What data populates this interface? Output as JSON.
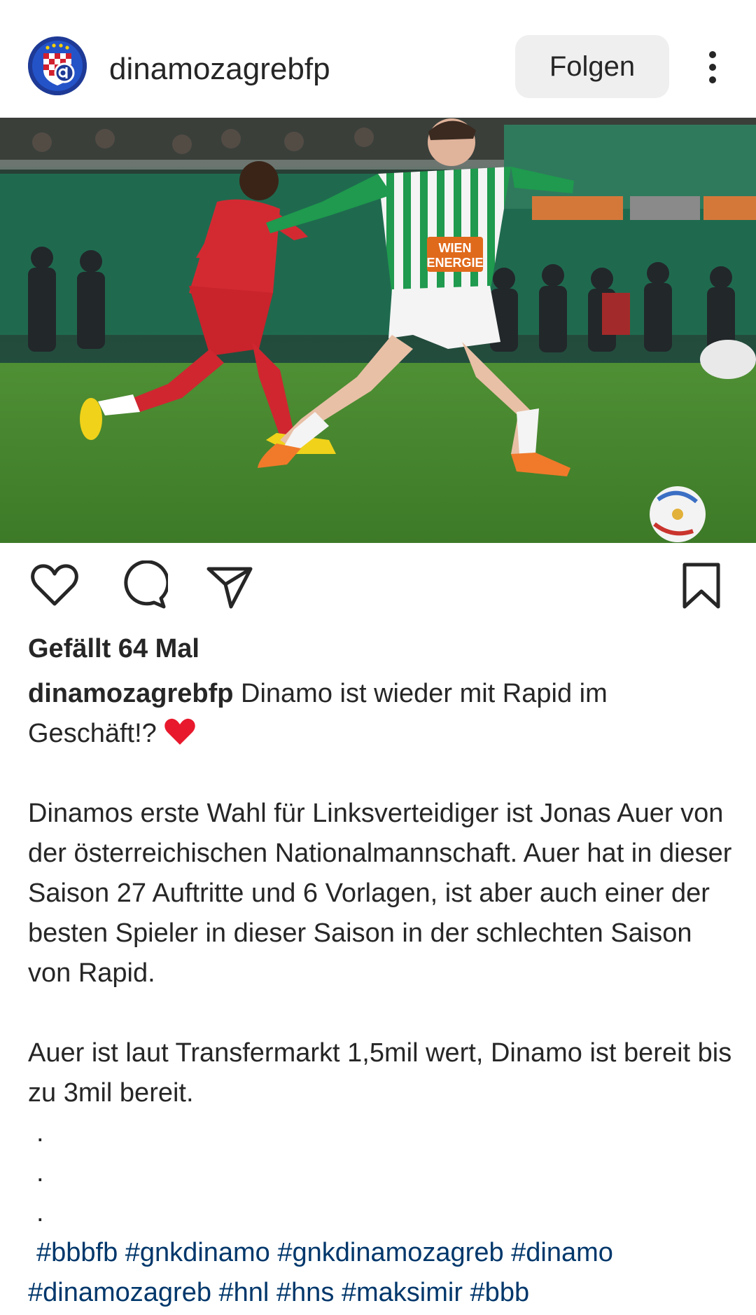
{
  "header": {
    "username": "dinamozagrebfp",
    "follow_label": "Folgen"
  },
  "post": {
    "likes_text": "Gefällt 64 Mal",
    "caption_user": "dinamozagrebfp",
    "caption_lines": {
      "first": "Dinamo ist wieder mit Rapid im Geschäft!?",
      "p1": "Dinamos erste Wahl für Linksverteidiger ist Jonas Auer von der österreichischen Nationalmannschaft. Auer hat in dieser Saison 27 Auftritte und 6 Vorlagen, ist aber auch einer der besten Spieler in dieser Saison in der schlechten Saison von Rapid.",
      "p2": "Auer ist laut Transfermarkt 1,5mil wert, Dinamo ist bereit bis zu 3mil bereit.",
      "dot": "."
    },
    "hashtags_line1": "#bbbfb #gnkdinamo #gnkdinamozagreb #dinamo",
    "hashtags_line2": "#dinamozagreb #hnl #hns #maksimir #bbb",
    "jersey_text_1": "WIEN",
    "jersey_text_2": "ENERGIE"
  },
  "icons": [
    "dinamo-crest-icon",
    "more-options-icon",
    "heart-icon",
    "comment-icon",
    "share-icon",
    "bookmark-icon",
    "red-heart-emoji"
  ],
  "colors": {
    "text": "#262626",
    "button_bg": "#efefef",
    "hashtag": "#00376b",
    "emoji_heart": "#e8192c"
  }
}
